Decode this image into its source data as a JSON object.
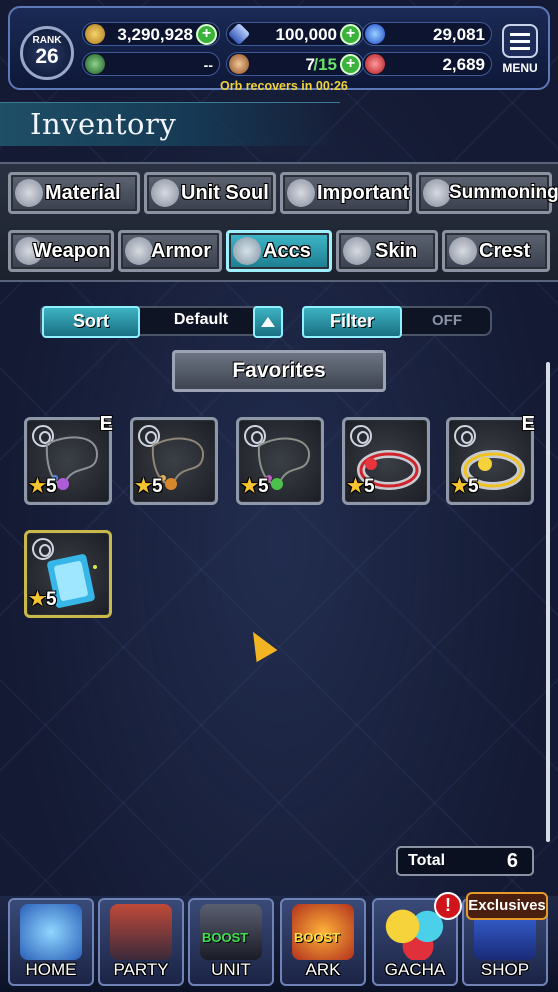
{
  "status": {
    "rank_label": "RANK",
    "rank_value": "26",
    "gil": "3,290,928",
    "lapis": "100,000",
    "blue_orbs": "29,081",
    "arena": "--",
    "orbs": "7",
    "orbs_max": "/15",
    "red_orbs": "2,689",
    "orb_note": "Orb recovers in 00:26",
    "menu_label": "MENU"
  },
  "header": {
    "title": "Inventory"
  },
  "tabs": {
    "row1": [
      {
        "label": "Material",
        "icon": "bag-icon"
      },
      {
        "label": "Unit Soul",
        "icon": "soul-icon"
      },
      {
        "label": "Important",
        "icon": "star-icon"
      },
      {
        "label": "Summoning",
        "icon": "summon-icon"
      }
    ],
    "row2": [
      {
        "label": "Weapon",
        "icon": "sword-icon"
      },
      {
        "label": "Armor",
        "icon": "armor-icon"
      },
      {
        "label": "Accs",
        "icon": "necklace-icon",
        "active": true
      },
      {
        "label": "Skin",
        "icon": "hanger-icon"
      },
      {
        "label": "Crest",
        "icon": "crest-icon"
      }
    ]
  },
  "controls": {
    "sort_label": "Sort",
    "sort_value": "Default",
    "filter_label": "Filter",
    "filter_state": "OFF",
    "favorites_label": "Favorites"
  },
  "items": [
    {
      "rarity": "5",
      "equipped": "E",
      "art": "silver-necklace-purple"
    },
    {
      "rarity": "5",
      "equipped": "",
      "art": "silver-necklace-orange"
    },
    {
      "rarity": "5",
      "equipped": "",
      "art": "silver-necklace-green"
    },
    {
      "rarity": "5",
      "equipped": "",
      "art": "red-bracelet"
    },
    {
      "rarity": "5",
      "equipped": "E",
      "art": "gold-bracelet"
    },
    {
      "rarity": "5",
      "equipped": "",
      "art": "crystal-card"
    }
  ],
  "total": {
    "label": "Total",
    "value": "6"
  },
  "nav": [
    {
      "label": "HOME"
    },
    {
      "label": "PARTY"
    },
    {
      "label": "UNIT",
      "badge": "BOOST"
    },
    {
      "label": "ARK",
      "badge": "BOOST"
    },
    {
      "label": "GACHA"
    },
    {
      "label": "SHOP"
    }
  ],
  "shop_badge": "Exclusives",
  "alert_badge": "!",
  "colors": {
    "accent": "#3cb3c2",
    "gold": "#f4c431",
    "orb_note": "#f1d23a"
  }
}
